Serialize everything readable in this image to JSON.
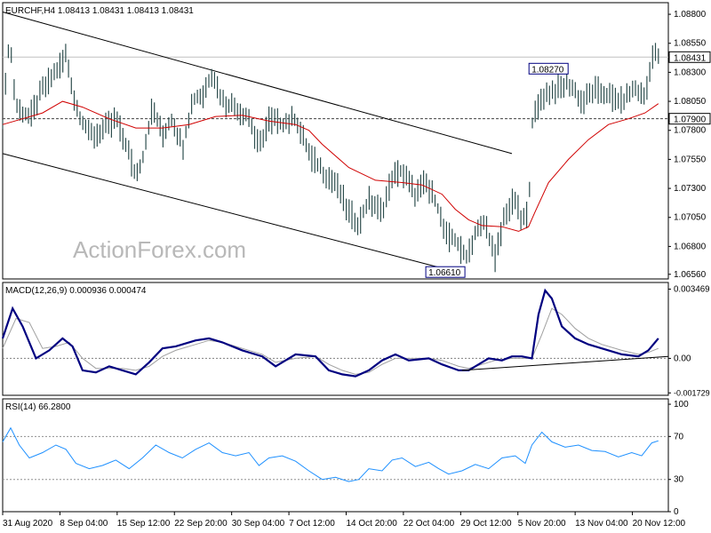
{
  "header": {
    "symbol_line": "EURCHF,H4  1.08413 1.08431 1.08413 1.08431",
    "macd_label": "MACD(12,26,9) 0.000936 0.000474",
    "rsi_label": "RSI(14) 66.2800"
  },
  "watermark": "ActionForex.com",
  "colors": {
    "background": "#ffffff",
    "price_bars": "#2f4f4f",
    "moving_average": "#d00000",
    "channel": "#000000",
    "macd_line": "#000080",
    "signal_line": "#a0a0a0",
    "rsi_line": "#1e90ff",
    "level_line": "#404040"
  },
  "chart_data": [
    {
      "type": "line",
      "panel": "price",
      "ylim": [
        1.0652,
        1.089
      ],
      "y_ticks": [
        "1.08800",
        "1.08550",
        "1.08300",
        "1.08050",
        "1.07800",
        "1.07550",
        "1.07300",
        "1.07050",
        "1.06800",
        "1.06560"
      ],
      "y_tick_values": [
        1.088,
        1.0855,
        1.083,
        1.0805,
        1.078,
        1.0755,
        1.073,
        1.0705,
        1.068,
        1.0656
      ],
      "current_price": {
        "label": "1.08431",
        "value": 1.08431
      },
      "horizontal_level": {
        "label": "1.07900",
        "value": 1.079
      },
      "annotations": [
        {
          "text": "1.08270",
          "x": 0.82,
          "y": 1.0827
        },
        {
          "text": "1.06610",
          "x": 0.665,
          "y": 1.0661
        }
      ],
      "channel": {
        "upper": [
          [
            0.0,
            1.0882
          ],
          [
            0.765,
            1.076
          ]
        ],
        "lower": [
          [
            0.0,
            1.076
          ],
          [
            0.655,
            1.0662
          ]
        ]
      },
      "price_path": [
        [
          0.0,
          1.0785
        ],
        [
          0.01,
          1.086
        ],
        [
          0.02,
          1.08
        ],
        [
          0.04,
          1.079
        ],
        [
          0.06,
          1.0815
        ],
        [
          0.08,
          1.083
        ],
        [
          0.095,
          1.0845
        ],
        [
          0.11,
          1.08
        ],
        [
          0.13,
          1.0775
        ],
        [
          0.15,
          1.078
        ],
        [
          0.17,
          1.079
        ],
        [
          0.19,
          1.076
        ],
        [
          0.2,
          1.074
        ],
        [
          0.21,
          1.0755
        ],
        [
          0.225,
          1.08
        ],
        [
          0.24,
          1.0775
        ],
        [
          0.255,
          1.079
        ],
        [
          0.27,
          1.0765
        ],
        [
          0.285,
          1.0805
        ],
        [
          0.3,
          1.081
        ],
        [
          0.315,
          1.083
        ],
        [
          0.33,
          1.0805
        ],
        [
          0.35,
          1.08
        ],
        [
          0.37,
          1.079
        ],
        [
          0.385,
          1.0765
        ],
        [
          0.4,
          1.079
        ],
        [
          0.42,
          1.0785
        ],
        [
          0.44,
          1.079
        ],
        [
          0.46,
          1.076
        ],
        [
          0.48,
          1.0745
        ],
        [
          0.5,
          1.0735
        ],
        [
          0.52,
          1.071
        ],
        [
          0.535,
          1.07
        ],
        [
          0.55,
          1.072
        ],
        [
          0.57,
          1.071
        ],
        [
          0.585,
          1.074
        ],
        [
          0.6,
          1.0745
        ],
        [
          0.62,
          1.0725
        ],
        [
          0.635,
          1.0735
        ],
        [
          0.65,
          1.072
        ],
        [
          0.665,
          1.069
        ],
        [
          0.68,
          1.0685
        ],
        [
          0.695,
          1.067
        ],
        [
          0.71,
          1.069
        ],
        [
          0.725,
          1.07
        ],
        [
          0.74,
          1.067
        ],
        [
          0.755,
          1.071
        ],
        [
          0.77,
          1.072
        ],
        [
          0.78,
          1.07
        ],
        [
          0.79,
          1.071
        ],
        [
          0.795,
          1.0785
        ],
        [
          0.81,
          1.081
        ],
        [
          0.83,
          1.0815
        ],
        [
          0.85,
          1.082
        ],
        [
          0.87,
          1.0805
        ],
        [
          0.89,
          1.0815
        ],
        [
          0.91,
          1.081
        ],
        [
          0.93,
          1.0805
        ],
        [
          0.95,
          1.0815
        ],
        [
          0.965,
          1.0808
        ],
        [
          0.975,
          1.0845
        ],
        [
          0.985,
          1.0843
        ]
      ],
      "moving_average": [
        [
          0.0,
          1.0785
        ],
        [
          0.03,
          1.079
        ],
        [
          0.06,
          1.0795
        ],
        [
          0.09,
          1.0805
        ],
        [
          0.12,
          1.08
        ],
        [
          0.16,
          1.079
        ],
        [
          0.2,
          1.0782
        ],
        [
          0.24,
          1.0782
        ],
        [
          0.28,
          1.0785
        ],
        [
          0.32,
          1.0792
        ],
        [
          0.36,
          1.0793
        ],
        [
          0.4,
          1.0788
        ],
        [
          0.44,
          1.0785
        ],
        [
          0.46,
          1.078
        ],
        [
          0.48,
          1.0768
        ],
        [
          0.52,
          1.0748
        ],
        [
          0.56,
          1.0737
        ],
        [
          0.6,
          1.0735
        ],
        [
          0.63,
          1.0733
        ],
        [
          0.66,
          1.0725
        ],
        [
          0.68,
          1.0712
        ],
        [
          0.7,
          1.0703
        ],
        [
          0.72,
          1.0698
        ],
        [
          0.75,
          1.0697
        ],
        [
          0.775,
          1.0693
        ],
        [
          0.79,
          1.0697
        ],
        [
          0.8,
          1.071
        ],
        [
          0.82,
          1.0735
        ],
        [
          0.85,
          1.0755
        ],
        [
          0.88,
          1.0772
        ],
        [
          0.91,
          1.0785
        ],
        [
          0.94,
          1.079
        ],
        [
          0.965,
          1.0795
        ],
        [
          0.985,
          1.0803
        ]
      ]
    },
    {
      "type": "line",
      "panel": "macd",
      "ylim": [
        -0.00185,
        0.0038
      ],
      "y_ticks": [
        "0.003469",
        "0.00",
        "-0.001729"
      ],
      "y_tick_values": [
        0.003469,
        0.0,
        -0.001729
      ],
      "zero_line_label": "0.00",
      "series": [
        {
          "role": "macd",
          "points": [
            [
              0.0,
              0.001
            ],
            [
              0.015,
              0.0025
            ],
            [
              0.03,
              0.0016
            ],
            [
              0.05,
              0.0
            ],
            [
              0.07,
              0.0004
            ],
            [
              0.09,
              0.001
            ],
            [
              0.105,
              0.0006
            ],
            [
              0.12,
              -0.0006
            ],
            [
              0.14,
              -0.0007
            ],
            [
              0.16,
              -0.0004
            ],
            [
              0.18,
              -0.0006
            ],
            [
              0.2,
              -0.0008
            ],
            [
              0.22,
              -0.0002
            ],
            [
              0.24,
              0.0005
            ],
            [
              0.26,
              0.0006
            ],
            [
              0.29,
              0.0009
            ],
            [
              0.31,
              0.001
            ],
            [
              0.33,
              0.0008
            ],
            [
              0.36,
              0.0004
            ],
            [
              0.39,
              0.0001
            ],
            [
              0.41,
              -0.0004
            ],
            [
              0.44,
              0.0002
            ],
            [
              0.47,
              0.0001
            ],
            [
              0.49,
              -0.0006
            ],
            [
              0.51,
              -0.0008
            ],
            [
              0.53,
              -0.0009
            ],
            [
              0.55,
              -0.0006
            ],
            [
              0.57,
              -0.0001
            ],
            [
              0.59,
              0.0002
            ],
            [
              0.61,
              -0.0001
            ],
            [
              0.64,
              0.0
            ],
            [
              0.66,
              -0.0003
            ],
            [
              0.685,
              -0.0006
            ],
            [
              0.7,
              -0.0006
            ],
            [
              0.72,
              -0.0002
            ],
            [
              0.73,
              0.0
            ],
            [
              0.75,
              -0.0001
            ],
            [
              0.765,
              0.0001
            ],
            [
              0.78,
              0.0001
            ],
            [
              0.795,
              0.0
            ],
            [
              0.805,
              0.0022
            ],
            [
              0.815,
              0.0034
            ],
            [
              0.825,
              0.003
            ],
            [
              0.84,
              0.0016
            ],
            [
              0.86,
              0.001
            ],
            [
              0.88,
              0.0007
            ],
            [
              0.9,
              0.0005
            ],
            [
              0.93,
              0.0002
            ],
            [
              0.955,
              0.0001
            ],
            [
              0.97,
              0.0004
            ],
            [
              0.985,
              0.001
            ]
          ]
        },
        {
          "role": "signal",
          "points": [
            [
              0.0,
              0.0005
            ],
            [
              0.02,
              0.002
            ],
            [
              0.04,
              0.0018
            ],
            [
              0.06,
              0.0005
            ],
            [
              0.08,
              0.0006
            ],
            [
              0.1,
              0.0008
            ],
            [
              0.12,
              0.0
            ],
            [
              0.14,
              -0.0005
            ],
            [
              0.16,
              -0.0005
            ],
            [
              0.18,
              -0.0005
            ],
            [
              0.2,
              -0.0006
            ],
            [
              0.22,
              -0.0004
            ],
            [
              0.24,
              0.0001
            ],
            [
              0.26,
              0.0004
            ],
            [
              0.29,
              0.0007
            ],
            [
              0.31,
              0.0009
            ],
            [
              0.33,
              0.0008
            ],
            [
              0.36,
              0.0005
            ],
            [
              0.39,
              0.0002
            ],
            [
              0.41,
              -0.0002
            ],
            [
              0.44,
              0.0
            ],
            [
              0.47,
              0.0001
            ],
            [
              0.49,
              -0.0003
            ],
            [
              0.51,
              -0.0006
            ],
            [
              0.53,
              -0.0008
            ],
            [
              0.55,
              -0.0007
            ],
            [
              0.57,
              -0.0003
            ],
            [
              0.59,
              0.0
            ],
            [
              0.61,
              0.0
            ],
            [
              0.64,
              0.0
            ],
            [
              0.66,
              -0.0001
            ],
            [
              0.685,
              -0.0004
            ],
            [
              0.7,
              -0.0005
            ],
            [
              0.72,
              -0.0003
            ],
            [
              0.74,
              -0.0001
            ],
            [
              0.765,
              0.0
            ],
            [
              0.795,
              0.0
            ],
            [
              0.81,
              0.0012
            ],
            [
              0.825,
              0.0025
            ],
            [
              0.84,
              0.0022
            ],
            [
              0.86,
              0.0015
            ],
            [
              0.88,
              0.001
            ],
            [
              0.9,
              0.0007
            ],
            [
              0.93,
              0.0004
            ],
            [
              0.955,
              0.0002
            ],
            [
              0.97,
              0.0003
            ],
            [
              0.985,
              0.0005
            ]
          ]
        }
      ],
      "trendline": [
        [
          0.69,
          -0.0006
        ],
        [
          1.0,
          0.0001
        ]
      ]
    },
    {
      "type": "line",
      "panel": "rsi",
      "ylim": [
        0,
        105
      ],
      "y_ticks": [
        "100",
        "70",
        "30",
        "0"
      ],
      "y_tick_values": [
        100,
        70,
        30,
        0
      ],
      "levels": [
        70,
        30
      ],
      "points": [
        [
          0.0,
          65
        ],
        [
          0.012,
          78
        ],
        [
          0.025,
          62
        ],
        [
          0.04,
          50
        ],
        [
          0.06,
          55
        ],
        [
          0.08,
          62
        ],
        [
          0.095,
          58
        ],
        [
          0.11,
          45
        ],
        [
          0.13,
          40
        ],
        [
          0.15,
          43
        ],
        [
          0.17,
          48
        ],
        [
          0.19,
          40
        ],
        [
          0.21,
          50
        ],
        [
          0.23,
          62
        ],
        [
          0.25,
          55
        ],
        [
          0.27,
          50
        ],
        [
          0.29,
          58
        ],
        [
          0.31,
          64
        ],
        [
          0.33,
          55
        ],
        [
          0.35,
          52
        ],
        [
          0.37,
          55
        ],
        [
          0.385,
          43
        ],
        [
          0.4,
          50
        ],
        [
          0.42,
          52
        ],
        [
          0.44,
          47
        ],
        [
          0.46,
          38
        ],
        [
          0.48,
          30
        ],
        [
          0.5,
          32
        ],
        [
          0.52,
          28
        ],
        [
          0.535,
          30
        ],
        [
          0.55,
          40
        ],
        [
          0.57,
          38
        ],
        [
          0.585,
          48
        ],
        [
          0.6,
          50
        ],
        [
          0.62,
          42
        ],
        [
          0.64,
          46
        ],
        [
          0.655,
          40
        ],
        [
          0.67,
          35
        ],
        [
          0.69,
          38
        ],
        [
          0.71,
          44
        ],
        [
          0.73,
          40
        ],
        [
          0.75,
          50
        ],
        [
          0.77,
          52
        ],
        [
          0.785,
          45
        ],
        [
          0.795,
          62
        ],
        [
          0.81,
          74
        ],
        [
          0.825,
          65
        ],
        [
          0.845,
          60
        ],
        [
          0.865,
          62
        ],
        [
          0.885,
          57
        ],
        [
          0.905,
          56
        ],
        [
          0.925,
          51
        ],
        [
          0.945,
          55
        ],
        [
          0.96,
          52
        ],
        [
          0.975,
          64
        ],
        [
          0.985,
          66
        ]
      ]
    }
  ],
  "x_axis": {
    "labels": [
      "31 Aug 2020",
      "8 Sep 04:00",
      "15 Sep 12:00",
      "22 Sep 20:00",
      "30 Sep 04:00",
      "7 Oct 12:00",
      "14 Oct 20:00",
      "22 Oct 04:00",
      "29 Oct 12:00",
      "5 Nov 20:00",
      "13 Nov 04:00",
      "20 Nov 12:00"
    ],
    "positions": [
      0.0,
      0.086,
      0.172,
      0.258,
      0.344,
      0.43,
      0.516,
      0.602,
      0.688,
      0.774,
      0.86,
      0.946
    ]
  }
}
